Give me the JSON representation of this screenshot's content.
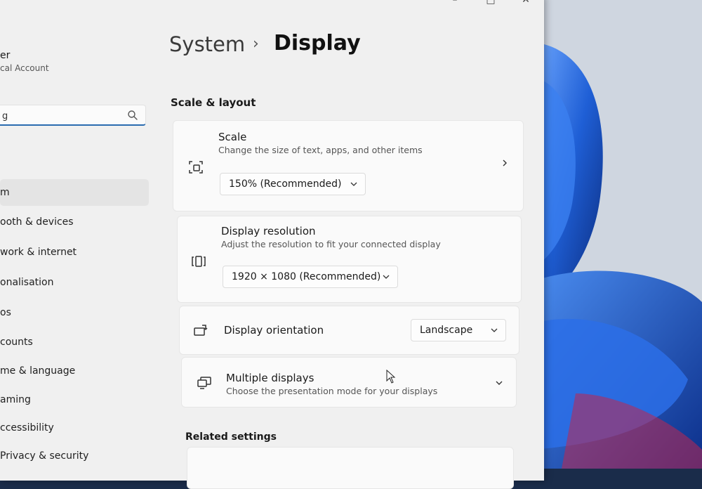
{
  "window": {
    "minimize_glyph": "–",
    "maximize_glyph": "□",
    "close_glyph": "✕"
  },
  "profile": {
    "name": "er",
    "account_type": "cal Account"
  },
  "search": {
    "value": "g"
  },
  "sidebar": {
    "items": [
      {
        "label": "m",
        "selected": true
      },
      {
        "label": "ooth & devices",
        "selected": false
      },
      {
        "label": "work & internet",
        "selected": false
      },
      {
        "label": "onalisation",
        "selected": false
      },
      {
        "label": "os",
        "selected": false
      },
      {
        "label": "counts",
        "selected": false
      },
      {
        "label": "me & language",
        "selected": false
      },
      {
        "label": "aming",
        "selected": false
      },
      {
        "label": "ccessibility",
        "selected": false
      },
      {
        "label": "Privacy & security",
        "selected": false
      }
    ]
  },
  "breadcrumb": {
    "parent": "System",
    "separator": "›",
    "current": "Display"
  },
  "scale_layout": {
    "section_title": "Scale & layout",
    "scale": {
      "title": "Scale",
      "description": "Change the size of text, apps, and other items",
      "value": "150% (Recommended)",
      "icon": "scale-icon"
    },
    "resolution": {
      "title": "Display resolution",
      "description": "Adjust the resolution to fit your connected display",
      "value": "1920 × 1080 (Recommended)",
      "icon": "resolution-icon"
    },
    "orientation": {
      "title": "Display orientation",
      "value": "Landscape",
      "icon": "orientation-icon"
    },
    "multiple_displays": {
      "title": "Multiple displays",
      "description": "Choose the presentation mode for your displays",
      "icon": "multiple-displays-icon"
    }
  },
  "related": {
    "section_title": "Related settings"
  },
  "colors": {
    "accent": "#2b6cb0",
    "window_bg": "#f0f0f0",
    "card_bg": "#fafafa",
    "wallpaper_blue": "#1d4fb0"
  }
}
